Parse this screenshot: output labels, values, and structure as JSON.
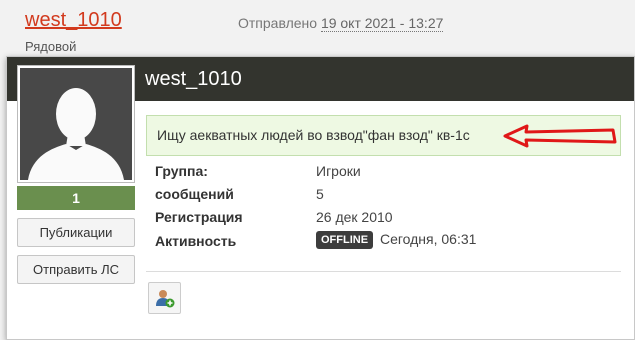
{
  "post_header": {
    "author_name": "west_1010",
    "author_rank": "Рядовой",
    "sent_prefix": "Отправлено",
    "sent_date": "19 окт 2021 - 13:27"
  },
  "card": {
    "name": "west_1010",
    "reputation": "1",
    "publications_label": "Публикации",
    "send_pm_label": "Отправить ЛС",
    "status_message": "Ищу аекватных людей во взвод\"фан взод\" кв-1с",
    "fields": [
      {
        "label": "Группа:",
        "value": "Игроки"
      },
      {
        "label": "сообщений",
        "value": "5"
      },
      {
        "label": "Регистрация",
        "value": "26 дек 2010"
      },
      {
        "label": "Активность",
        "value": "Сегодня, 06:31"
      }
    ],
    "offline_badge": "OFFLINE"
  },
  "colors": {
    "author_link": "#d23a1e",
    "header_bar": "#33342e",
    "reputation_bg": "#6a8f4e",
    "status_bg": "#eef9e3",
    "annotation_arrow": "#e01818"
  },
  "icons": {
    "avatar": "default-avatar-silhouette",
    "arrow": "red-hand-drawn-arrow",
    "add_friend": "add-friend-icon"
  }
}
